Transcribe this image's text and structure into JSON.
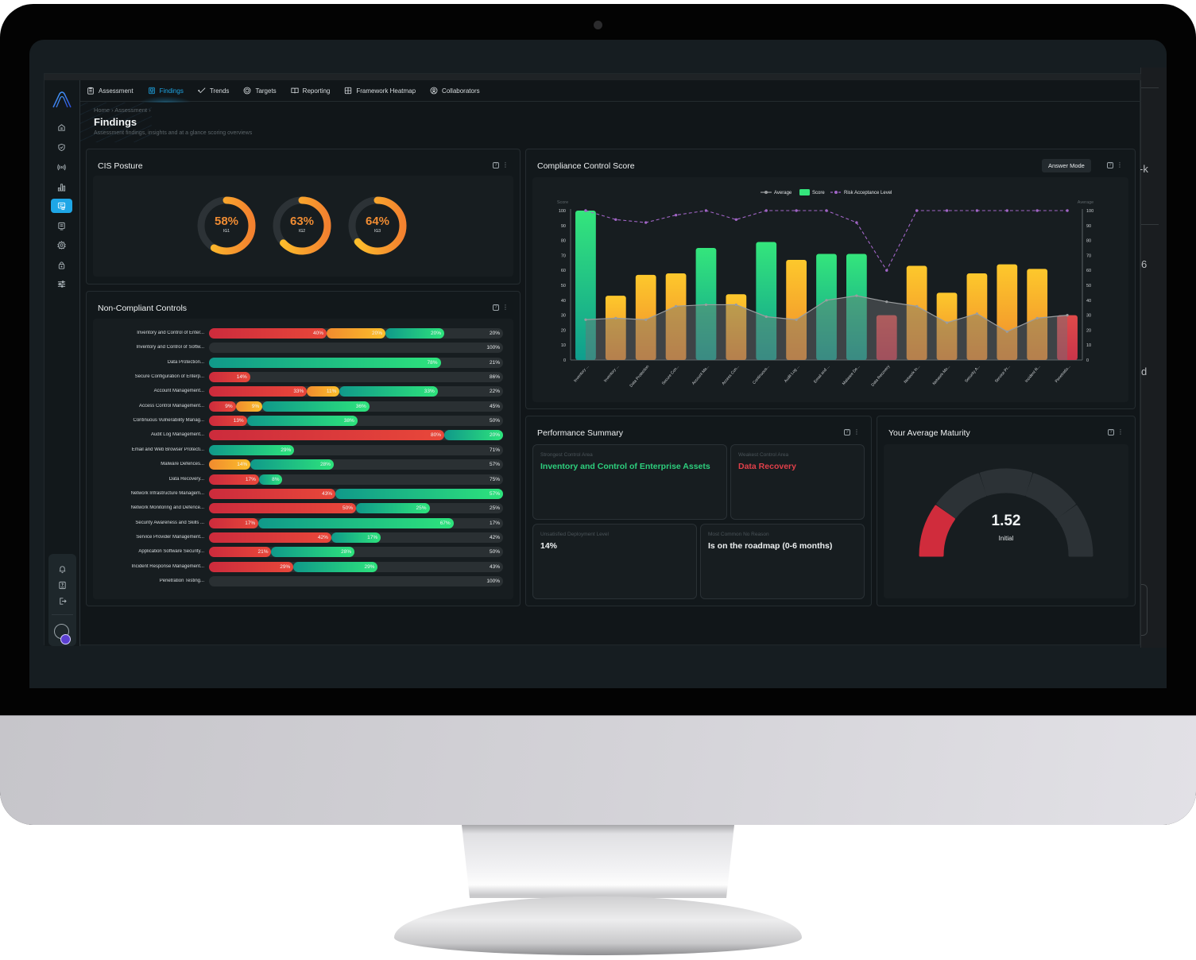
{
  "nav": {
    "tabs": [
      {
        "label": "Assessment",
        "icon": "clipboard-list-icon",
        "active": false
      },
      {
        "label": "Findings",
        "icon": "findings-icon",
        "active": true
      },
      {
        "label": "Trends",
        "icon": "trend-line-icon",
        "active": false
      },
      {
        "label": "Targets",
        "icon": "target-icon",
        "active": false
      },
      {
        "label": "Reporting",
        "icon": "book-open-icon",
        "active": false
      },
      {
        "label": "Framework Heatmap",
        "icon": "grid-icon",
        "active": false
      },
      {
        "label": "Collaborators",
        "icon": "user-badge-icon",
        "active": false
      }
    ]
  },
  "sidebar": {
    "items": [
      {
        "icon": "home-icon",
        "active": false
      },
      {
        "icon": "shield-check-icon",
        "active": false
      },
      {
        "icon": "broadcast-icon",
        "active": false
      },
      {
        "icon": "bar-chart-icon",
        "active": false
      },
      {
        "icon": "findings-icon",
        "active": true
      },
      {
        "icon": "report-icon",
        "active": false
      },
      {
        "icon": "gear-icon",
        "active": false
      },
      {
        "icon": "lock-icon",
        "active": false
      },
      {
        "icon": "sliders-icon",
        "active": false
      }
    ],
    "bottom": [
      {
        "icon": "bell-icon"
      },
      {
        "icon": "help-book-icon"
      },
      {
        "icon": "logout-icon"
      }
    ]
  },
  "header": {
    "breadcrumb": "Home  ›  Assessment  ›",
    "title": "Findings",
    "subtitle": "Assessment findings, insights and at a glance scoring overviews"
  },
  "cis_posture": {
    "title": "CIS Posture",
    "donuts": [
      {
        "value": 58,
        "display": "58%",
        "label": "IG1"
      },
      {
        "value": 63,
        "display": "63%",
        "label": "IG2"
      },
      {
        "value": 64,
        "display": "64%",
        "label": "IG3"
      }
    ]
  },
  "non_compliant": {
    "title": "Non-Compliant Controls",
    "rows": [
      {
        "label": "Inventory and Control of Enter...",
        "red": 40,
        "orange": 20,
        "green": 20,
        "rest": 20
      },
      {
        "label": "Inventory and Control of Softw...",
        "red": 0,
        "orange": 0,
        "green": 0,
        "rest": 100
      },
      {
        "label": "Data Protection...",
        "red": 0,
        "orange": 0,
        "green": 78,
        "rest": 21
      },
      {
        "label": "Secure Configuration of Enterp...",
        "red": 14,
        "orange": 0,
        "green": 0,
        "rest": 86
      },
      {
        "label": "Account Management...",
        "red": 33,
        "orange": 11,
        "green": 33,
        "rest": 22
      },
      {
        "label": "Access Control Management...",
        "red": 9,
        "orange": 9,
        "green": 36,
        "rest": 45
      },
      {
        "label": "Continuous Vulnerability Manag...",
        "red": 13,
        "orange": 0,
        "green": 38,
        "rest": 50
      },
      {
        "label": "Audit Log Management...",
        "red": 80,
        "orange": 0,
        "green": 20,
        "rest": 0
      },
      {
        "label": "Email and Web Browser Protecti...",
        "red": 0,
        "orange": 0,
        "green": 29,
        "rest": 71
      },
      {
        "label": "Malware Defences...",
        "red": 0,
        "orange": 14,
        "green": 28,
        "rest": 57
      },
      {
        "label": "Data Recovery...",
        "red": 17,
        "orange": 0,
        "green": 8,
        "rest": 75
      },
      {
        "label": "Network Infrastructure Managem...",
        "red": 43,
        "orange": 0,
        "green": 57,
        "rest": 0
      },
      {
        "label": "Network Monitoring and Defence...",
        "red": 50,
        "orange": 0,
        "green": 25,
        "rest": 25
      },
      {
        "label": "Security Awareness and Skills ...",
        "red": 17,
        "orange": 0,
        "green": 67,
        "rest": 17
      },
      {
        "label": "Service Provider Management...",
        "red": 42,
        "orange": 0,
        "green": 17,
        "rest": 42
      },
      {
        "label": "Application Software Security...",
        "red": 21,
        "orange": 0,
        "green": 28,
        "rest": 50
      },
      {
        "label": "Incident Response Management...",
        "red": 29,
        "orange": 0,
        "green": 29,
        "rest": 43
      },
      {
        "label": "Penetration Testing...",
        "red": 0,
        "orange": 0,
        "green": 0,
        "rest": 100
      }
    ]
  },
  "compliance": {
    "title": "Compliance Control Score",
    "answer_mode_label": "Answer Mode"
  },
  "chart_data": {
    "type": "bar",
    "title": "Compliance Control Score",
    "ylabel": "Score",
    "y2label": "Average",
    "ylim": [
      0,
      100
    ],
    "y2lim": [
      0,
      100
    ],
    "yticks": [
      0,
      10,
      20,
      30,
      40,
      50,
      60,
      70,
      80,
      90,
      100
    ],
    "legend": [
      "Average",
      "Score",
      "Risk Acceptance Level"
    ],
    "legend_position": "top-center",
    "categories": [
      "Inventory ...",
      "Inventory ...",
      "Data Protection",
      "Secure Con...",
      "Account Ma...",
      "Access Con...",
      "Continuous...",
      "Audit Log ...",
      "Email and ...",
      "Malware De...",
      "Data Recovery",
      "Network In...",
      "Network Mo...",
      "Security A...",
      "Service Pr...",
      "Incident R...",
      "Penetratio..."
    ],
    "series": [
      {
        "name": "Score",
        "kind": "bar",
        "values": [
          100,
          43,
          57,
          58,
          75,
          44,
          79,
          67,
          71,
          71,
          30,
          63,
          45,
          58,
          64,
          61,
          30
        ],
        "colors": [
          "green",
          "orange",
          "orange",
          "orange",
          "green",
          "orange",
          "green",
          "orange",
          "green",
          "green",
          "red",
          "orange",
          "orange",
          "orange",
          "orange",
          "orange",
          "red"
        ]
      },
      {
        "name": "Average",
        "kind": "area-line",
        "values": [
          27,
          28,
          27,
          36,
          37,
          37,
          29,
          27,
          40,
          43,
          39,
          36,
          25,
          31,
          19,
          28,
          30
        ]
      },
      {
        "name": "Risk Acceptance Level",
        "kind": "dashed-line",
        "values": [
          100,
          94,
          92,
          97,
          100,
          94,
          100,
          100,
          100,
          92,
          60,
          100,
          100,
          100,
          100,
          100,
          100
        ]
      }
    ],
    "colors": {
      "green_top": "#34e57c",
      "green_bottom": "#0f9e8e",
      "orange_top": "#fdc82c",
      "orange_bottom": "#f08a2c",
      "red": "#dc3a45",
      "average": "#9a9d9f",
      "risk": "#a165c6"
    }
  },
  "performance": {
    "title": "Performance Summary",
    "strongest_caption": "Strongest Control Area",
    "strongest_value": "Inventory and Control of Enterprise Assets",
    "weakest_caption": "Weakest Control Area",
    "weakest_value": "Data Recovery",
    "unsatisfied_caption": "Unsatisfied Deployment Level",
    "unsatisfied_value": "14%",
    "reason_caption": "Most Common No Reason",
    "reason_value": "Is on the roadmap (0-6 months)"
  },
  "maturity": {
    "title": "Your Average Maturity",
    "value": "1.52",
    "level": "Initial",
    "segments_total": 5,
    "segments_filled": 1
  },
  "background_window": {
    "fragments": [
      "-k",
      "6",
      "d"
    ]
  }
}
